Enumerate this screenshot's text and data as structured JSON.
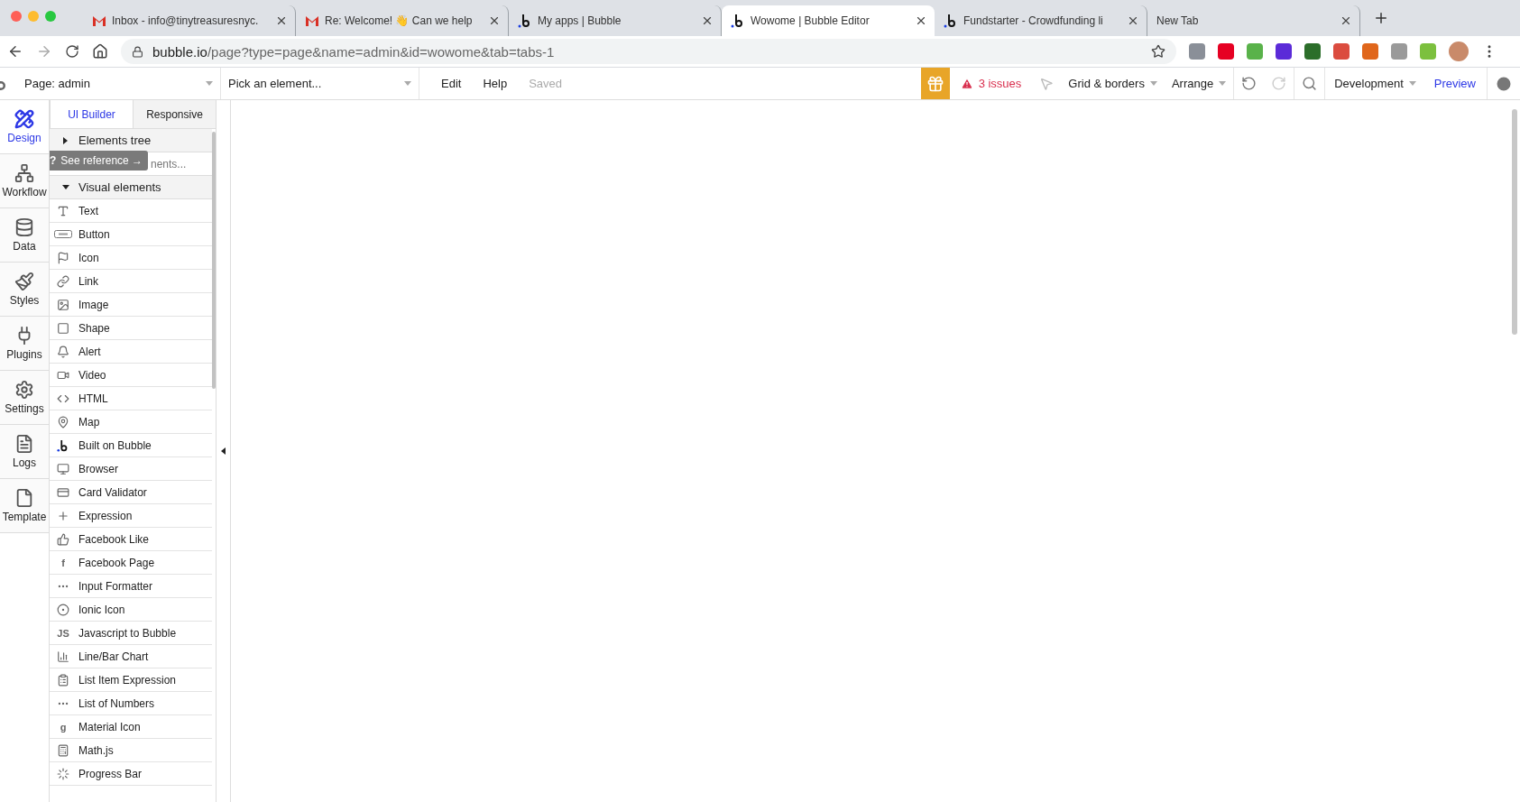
{
  "browser_tabs": [
    {
      "title": "Inbox - info@tinytreasuresnyc.",
      "kind": "gmail",
      "selected": false
    },
    {
      "title": "Re: Welcome! 👋 Can we help",
      "kind": "gmail",
      "selected": false
    },
    {
      "title": "My apps | Bubble",
      "kind": "bubble",
      "selected": false
    },
    {
      "title": "Wowome | Bubble Editor",
      "kind": "bubble",
      "selected": true
    },
    {
      "title": "Fundstarter - Crowdfunding li",
      "kind": "bubble",
      "selected": false
    },
    {
      "title": "New Tab",
      "kind": "plain",
      "selected": false
    }
  ],
  "address_bar": {
    "host": "bubble.io",
    "path": "/page?type=page&name=admin&id=wowome&tab=tabs-1"
  },
  "toolbar": {
    "page_select": "Page: admin",
    "element_select": "Pick an element...",
    "menus": [
      "Edit",
      "Help"
    ],
    "save_status": "Saved",
    "issues": "3 issues",
    "grid_menu": "Grid & borders",
    "arrange_menu": "Arrange",
    "mode_select": "Development",
    "preview": "Preview"
  },
  "nav": [
    {
      "label": "Design",
      "kind": "design",
      "selected": true
    },
    {
      "label": "Workflow",
      "kind": "workflow",
      "selected": false
    },
    {
      "label": "Data",
      "kind": "data",
      "selected": false
    },
    {
      "label": "Styles",
      "kind": "styles",
      "selected": false
    },
    {
      "label": "Plugins",
      "kind": "plugins",
      "selected": false
    },
    {
      "label": "Settings",
      "kind": "settings",
      "selected": false
    },
    {
      "label": "Logs",
      "kind": "logs",
      "selected": false
    },
    {
      "label": "Template",
      "kind": "template",
      "selected": false
    }
  ],
  "panel_tabs": [
    {
      "label": "UI Builder",
      "selected": true
    },
    {
      "label": "Responsive",
      "selected": false
    }
  ],
  "elements_tree": {
    "label": "Elements tree",
    "expanded": false
  },
  "search": {
    "placeholder": "nents..."
  },
  "tooltip": {
    "label": "See reference →",
    "glyph": "?"
  },
  "visual_elements": {
    "label": "Visual elements",
    "expanded": true,
    "items": [
      {
        "label": "Text",
        "kind": "text"
      },
      {
        "label": "Button",
        "kind": "button"
      },
      {
        "label": "Icon",
        "kind": "flag"
      },
      {
        "label": "Link",
        "kind": "link"
      },
      {
        "label": "Image",
        "kind": "image"
      },
      {
        "label": "Shape",
        "kind": "shape"
      },
      {
        "label": "Alert",
        "kind": "alert"
      },
      {
        "label": "Video",
        "kind": "video"
      },
      {
        "label": "HTML",
        "kind": "html"
      },
      {
        "label": "Map",
        "kind": "map"
      },
      {
        "label": "Built on Bubble",
        "kind": "bubble"
      },
      {
        "label": "Browser",
        "kind": "browser"
      },
      {
        "label": "Card Validator",
        "kind": "card"
      },
      {
        "label": "Expression",
        "kind": "plus"
      },
      {
        "label": "Facebook Like",
        "kind": "like"
      },
      {
        "label": "Facebook Page",
        "kind": "glyph",
        "glyph": "f"
      },
      {
        "label": "Input Formatter",
        "kind": "dots"
      },
      {
        "label": "Ionic Icon",
        "kind": "radio"
      },
      {
        "label": "Javascript to Bubble",
        "kind": "glyph",
        "glyph": "JS"
      },
      {
        "label": "Line/Bar Chart",
        "kind": "chart"
      },
      {
        "label": "List Item Expression",
        "kind": "clipboard"
      },
      {
        "label": "List of Numbers",
        "kind": "dots"
      },
      {
        "label": "Material Icon",
        "kind": "glyph",
        "glyph": "g"
      },
      {
        "label": "Math.js",
        "kind": "calculator"
      },
      {
        "label": "Progress Bar",
        "kind": "progress"
      }
    ]
  }
}
